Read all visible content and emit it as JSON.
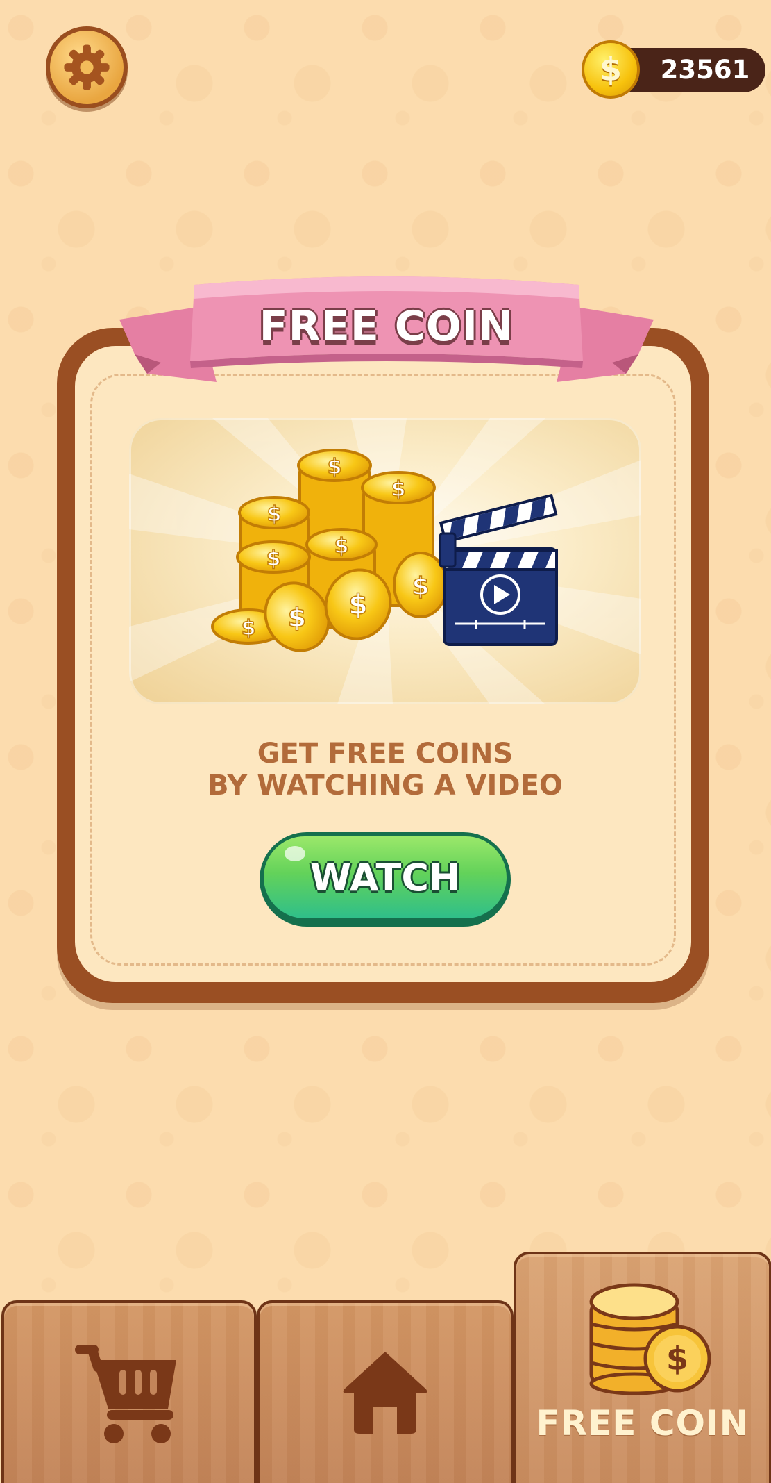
{
  "top_bar": {
    "settings_icon": "gear-icon",
    "coin_icon": "dollar-coin-icon",
    "coin_symbol": "$",
    "coin_balance": "23561"
  },
  "card": {
    "title": "FREE COIN",
    "reward_image": [
      "coin-pile-icon",
      "clapperboard-icon",
      "play-icon"
    ],
    "coin_symbol": "$",
    "message_line1": "GET FREE COINS",
    "message_line2": "BY WATCHING A VIDEO",
    "watch_label": "WATCH"
  },
  "bottom_nav": {
    "tabs": [
      {
        "icon": "shopping-cart-icon",
        "label": ""
      },
      {
        "icon": "home-icon",
        "label": ""
      },
      {
        "icon": "coin-stack-icon",
        "label": "FREE COIN",
        "active": true
      }
    ],
    "coin_symbol": "$"
  },
  "colors": {
    "background": "#fcdcae",
    "card_frame": "#9a4f23",
    "ribbon": "#ee93b3",
    "watch_button": "#63d25a",
    "coin": "#f7c20d",
    "clapperboard": "#1f3476"
  }
}
